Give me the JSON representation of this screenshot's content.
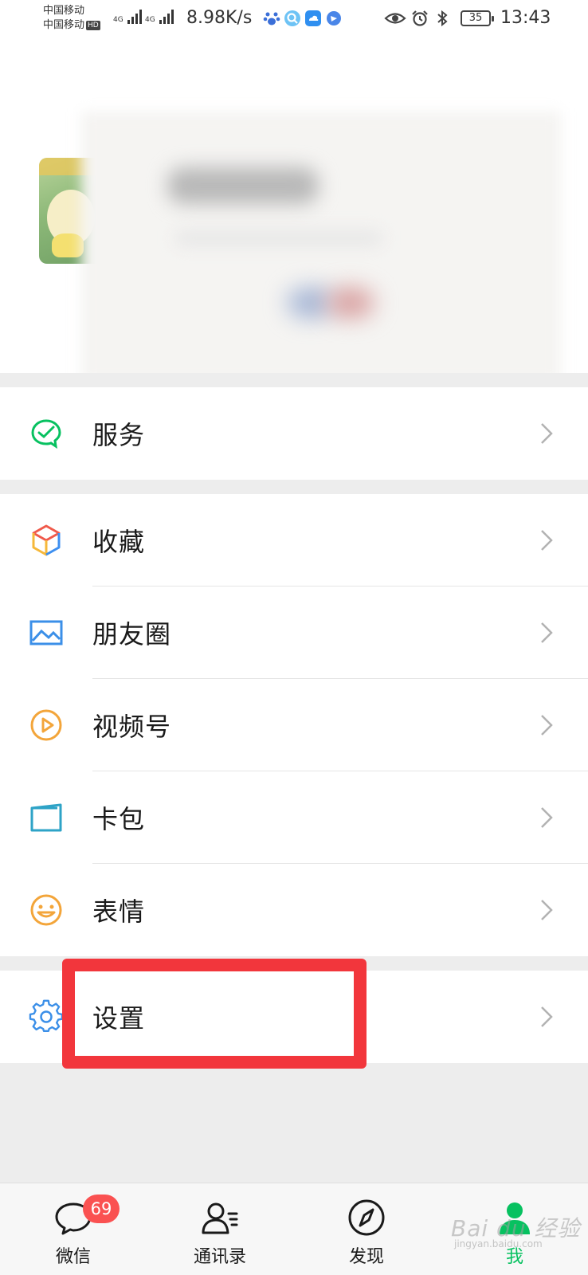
{
  "status_bar": {
    "carrier_1": "中国移动",
    "carrier_2": "中国移动",
    "hd": "HD",
    "net_1": "4G",
    "net_2": "4G",
    "speed": "8.98K/s",
    "battery": "35",
    "time": "13:43"
  },
  "menu": {
    "services": "服务",
    "favorites": "收藏",
    "moments": "朋友圈",
    "channels": "视频号",
    "cards": "卡包",
    "stickers": "表情",
    "settings": "设置"
  },
  "tabbar": {
    "chats": "微信",
    "chats_badge": "69",
    "contacts": "通讯录",
    "discover": "发现",
    "me": "我"
  },
  "watermark": {
    "text": "Bai du 经验",
    "sub": "jingyan.baidu.com"
  },
  "colors": {
    "wechat_green": "#07c160",
    "badge_red": "#fa5151",
    "highlight_red": "#f2363c"
  }
}
